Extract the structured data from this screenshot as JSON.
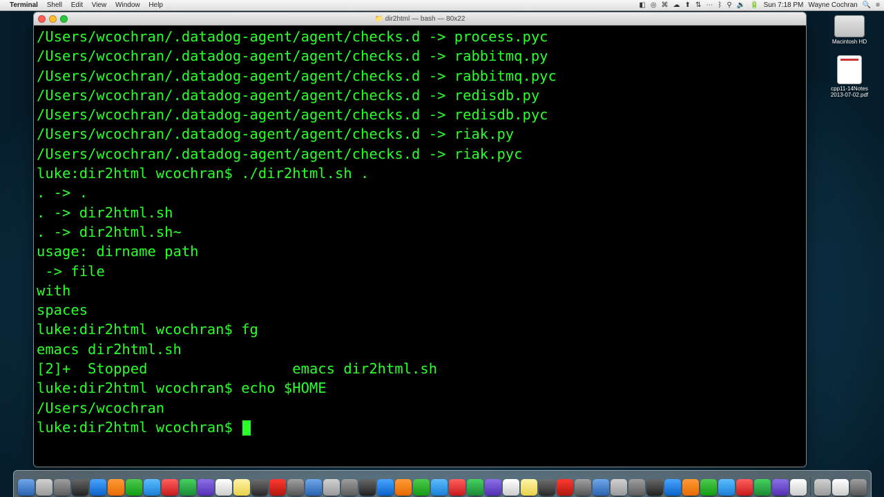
{
  "menubar": {
    "apple": "",
    "app": "Terminal",
    "items": [
      "Shell",
      "Edit",
      "View",
      "Window",
      "Help"
    ],
    "clock": "Sun 7:18 PM",
    "user": "Wayne Cochran",
    "status_icons": [
      "bt-icon",
      "battery-icon",
      "wifi-icon",
      "volume-icon",
      "sync-icon",
      "airplay-icon",
      "eye-icon",
      "cloud-icon",
      "db-icon",
      "display-icon"
    ]
  },
  "window": {
    "title": "dir2html — bash — 80x22",
    "doc_icon": "📁"
  },
  "terminal": {
    "lines": [
      "/Users/wcochran/.datadog-agent/agent/checks.d -> process.pyc",
      "/Users/wcochran/.datadog-agent/agent/checks.d -> rabbitmq.py",
      "/Users/wcochran/.datadog-agent/agent/checks.d -> rabbitmq.pyc",
      "/Users/wcochran/.datadog-agent/agent/checks.d -> redisdb.py",
      "/Users/wcochran/.datadog-agent/agent/checks.d -> redisdb.pyc",
      "/Users/wcochran/.datadog-agent/agent/checks.d -> riak.py",
      "/Users/wcochran/.datadog-agent/agent/checks.d -> riak.pyc",
      "luke:dir2html wcochran$ ./dir2html.sh .",
      ". -> .",
      ". -> dir2html.sh",
      ". -> dir2html.sh~",
      "usage: dirname path",
      " -> file",
      "with",
      "spaces",
      "luke:dir2html wcochran$ fg",
      "emacs dir2html.sh",
      "",
      "[2]+  Stopped                 emacs dir2html.sh",
      "luke:dir2html wcochran$ echo $HOME",
      "/Users/wcochran",
      "luke:dir2html wcochran$ "
    ]
  },
  "desktop": {
    "hd_label": "Macintosh HD",
    "pdf_label": "cpp11-14Notes\n2013-07-02.pdf"
  },
  "dock": {
    "apps": [
      "finder",
      "launchpad",
      "appstore",
      "terminal",
      "safari",
      "firefox",
      "chrome",
      "messages",
      "skype",
      "dropbox",
      "mail",
      "bbedit",
      "twitter",
      "calendar",
      "notes",
      "reminders",
      "preview",
      "itunes",
      "photos",
      "pages",
      "numbers",
      "keynote",
      "map",
      "aperture",
      "ical",
      "textmate",
      "vlc",
      "github",
      "sourcetree",
      "steam",
      "xcode",
      "eclipse",
      "sublime",
      "atom",
      "vscode",
      "evernote",
      "spotify",
      "slack",
      "kindle",
      "transmit",
      "cyberduck",
      "disk",
      "parallels",
      "screenflow"
    ]
  }
}
